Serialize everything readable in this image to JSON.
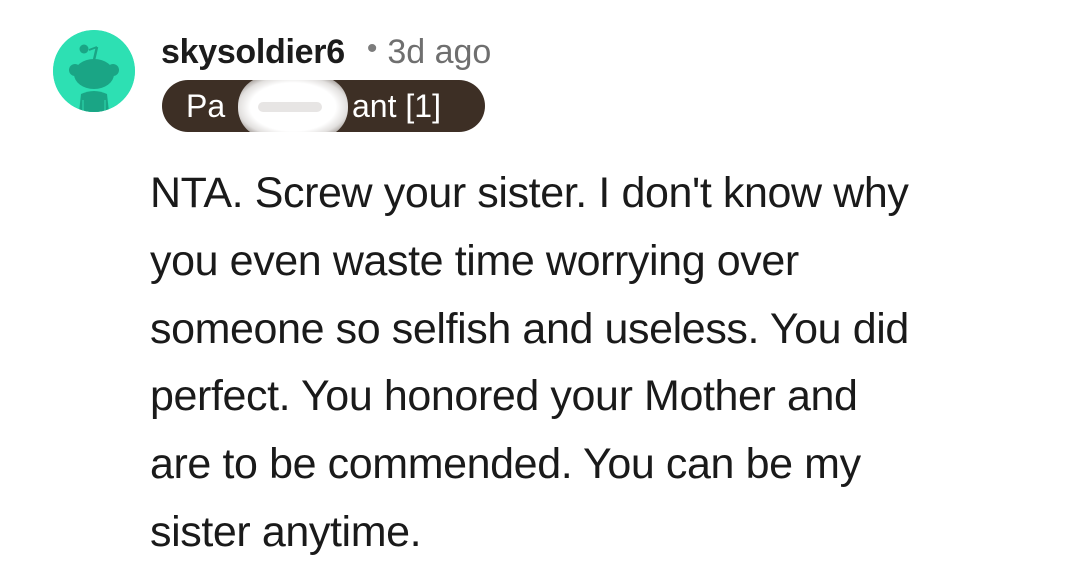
{
  "comment": {
    "author": "skysoldier6",
    "separator": "•",
    "timestamp": "3d ago",
    "flair": {
      "visible_prefix": "Pa",
      "visible_suffix": "ant [1]",
      "background_color": "#3d2f25"
    },
    "avatar": {
      "icon": "reddit-snoo-avatar-icon",
      "background_color": "#2de0b3"
    },
    "body_lines": [
      "NTA. Screw your sister. I don't know why",
      "you even waste time worrying over",
      "someone so selfish and useless. You did",
      "perfect. You honored your Mother and",
      "are to be commended. You can be my",
      "sister anytime."
    ]
  }
}
